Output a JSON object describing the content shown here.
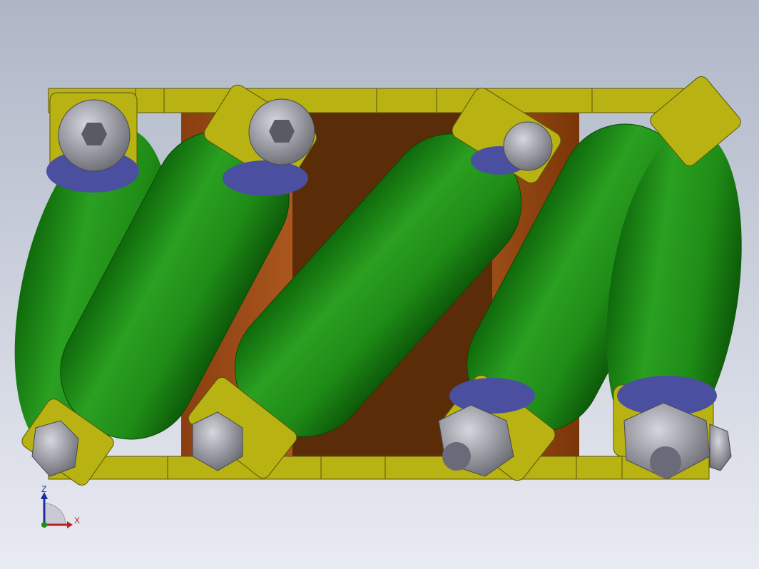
{
  "viewport": {
    "background_top": "#aeb6c6",
    "background_bottom": "#e9ebf2"
  },
  "model": {
    "frame_color": "#b8b212",
    "hub_color": "#a4521a",
    "hub_dark_color": "#5a2c08",
    "roller_color": "#1f8c17",
    "bushing_color": "#4a4fa0",
    "fastener_color": "#8e8e96"
  },
  "triad": {
    "z_label": "Z",
    "x_label": "X",
    "z_color": "#1c2ea0",
    "x_color": "#b82020",
    "y_color": "#1c8c1c"
  }
}
